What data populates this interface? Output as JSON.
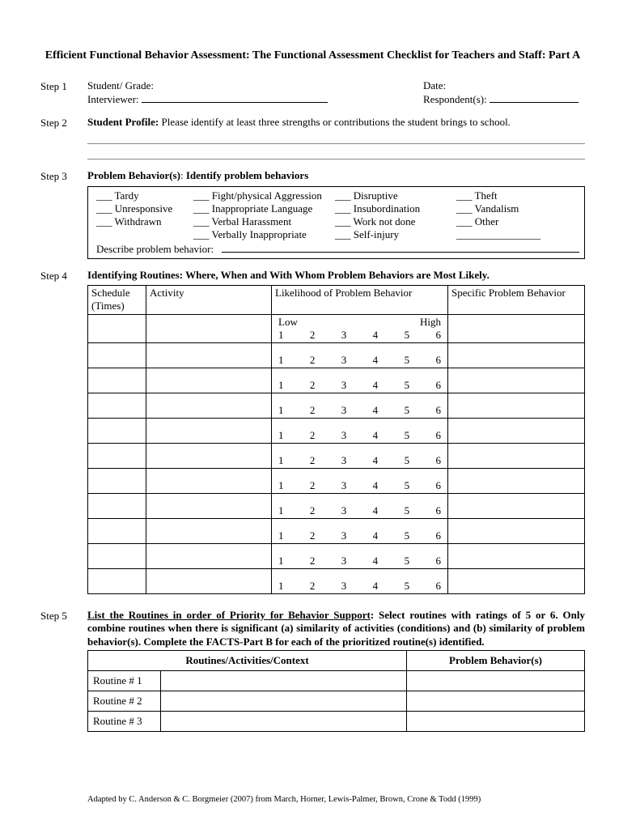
{
  "title": "Efficient Functional Behavior Assessment: The Functional Assessment Checklist for Teachers and Staff: Part A",
  "steps": {
    "s1": "Step 1",
    "s2": "Step 2",
    "s3": "Step 3",
    "s4": "Step 4",
    "s5": "Step 5"
  },
  "step1": {
    "student_grade_label": "Student/ Grade:",
    "date_label": "Date:",
    "interviewer_label": "Interviewer:",
    "respondents_label": "Respondent(s):"
  },
  "step2": {
    "profile_label": "Student Profile:",
    "profile_text": " Please identify at least three strengths or contributions the student brings to school."
  },
  "step3": {
    "heading_label": "Problem Behavior(s)",
    "heading_colon": ":  ",
    "heading_text": "Identify problem behaviors",
    "col1": [
      "Tardy",
      "Unresponsive",
      "Withdrawn"
    ],
    "col2": [
      "Fight/physical Aggression",
      "Inappropriate Language",
      "Verbal Harassment",
      "Verbally Inappropriate"
    ],
    "col3": [
      "Disruptive",
      "Insubordination",
      "Work not done",
      "Self-injury"
    ],
    "col4": [
      "Theft",
      "Vandalism",
      "Other ________________"
    ],
    "describe": "Describe problem behavior:"
  },
  "step4": {
    "heading": "Identifying Routines: Where, When and With Whom Problem Behaviors are Most Likely.",
    "headers": {
      "schedule": "Schedule (Times)",
      "activity": "Activity",
      "likelihood": "Likelihood of Problem Behavior",
      "specific": "Specific Problem Behavior"
    },
    "scale_low": "Low",
    "scale_high": "High",
    "scale": [
      "1",
      "2",
      "3",
      "4",
      "5",
      "6"
    ],
    "row_count": 11
  },
  "step5": {
    "heading_bold": "List the Routines in order of Priority for Behavior Support",
    "heading_rest": ": Select routines with ratings of 5 or 6.  Only combine routines when there is significant (a) similarity of activities (conditions) and (b) similarity of problem behavior(s).  Complete the FACTS-Part B for each of the prioritized routine(s) identified.",
    "th_context": "Routines/Activities/Context",
    "th_behavior": "Problem Behavior(s)",
    "rows": [
      "Routine # 1",
      "Routine # 2",
      "Routine # 3"
    ]
  },
  "footer": "Adapted by C. Anderson & C. Borgmeier (2007) from March, Horner, Lewis-Palmer, Brown, Crone & Todd (1999)"
}
